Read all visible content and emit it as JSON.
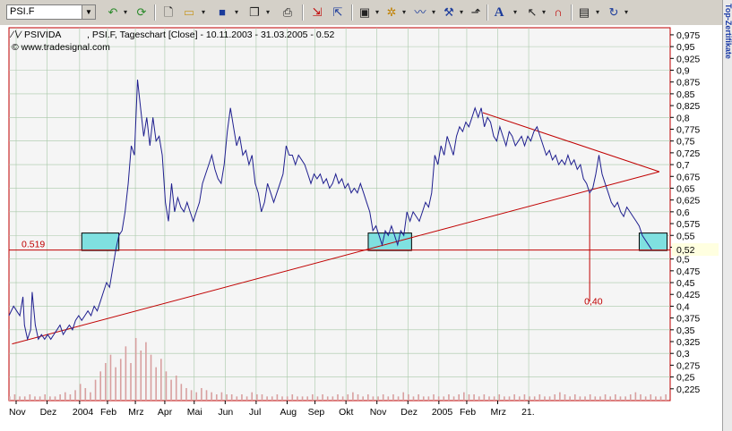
{
  "toolbar": {
    "symbol_value": "PSI.F",
    "buttons": [
      "undo-icon",
      "refresh-icon",
      "new-icon",
      "open-icon",
      "save-icon",
      "copy-icon",
      "print-icon",
      "chart-in-icon",
      "chart-out-icon",
      "window-icon",
      "studies-icon",
      "indicators-icon",
      "tools-icon",
      "trend-icon",
      "text-icon",
      "cursor-icon",
      "magnet-icon",
      "properties-icon",
      "redo-icon"
    ]
  },
  "side_panel": {
    "label": "Top-Zertifikate"
  },
  "chart_header": {
    "instrument": "PSIVIDA",
    "description": ", PSI.F, Tageschart [Close] - 10.11.2003 - 31.03.2005 - 0.52",
    "source": "© www.tradesignal.com"
  },
  "colors": {
    "price_line": "#1f1f8f",
    "annotation": "#c00000",
    "box_fill": "#7fe0e0",
    "grid": "#a8c8a8",
    "volume": "#d8a0a0",
    "frame": "#c00000"
  },
  "chart_data": {
    "type": "line",
    "title": "PSIVIDA , PSI.F, Tageschart [Close] - 10.11.2003 - 31.03.2005 - 0.52",
    "xlabel": "",
    "ylabel": "",
    "ylim": [
      0.2,
      0.99
    ],
    "grid": true,
    "x_ticks": [
      "Nov",
      "Dez",
      "2004",
      "Feb",
      "Mrz",
      "Apr",
      "Mai",
      "Jun",
      "Jul",
      "Aug",
      "Sep",
      "Okt",
      "Nov",
      "Dez",
      "2005",
      "Feb",
      "Mrz",
      "21."
    ],
    "y_ticks": [
      "0,975",
      "0,95",
      "0,925",
      "0,9",
      "0,875",
      "0,85",
      "0,825",
      "0,8",
      "0,775",
      "0,75",
      "0,725",
      "0,7",
      "0,675",
      "0,65",
      "0,625",
      "0,6",
      "0,575",
      "0,55",
      "0,525",
      "0,5",
      "0,475",
      "0,45",
      "0,425",
      "0,4",
      "0,375",
      "0,35",
      "0,325",
      "0,3",
      "0,275",
      "0,25",
      "0,225"
    ],
    "last_value_label": "0,52",
    "series": [
      {
        "values": [
          [
            0,
            0.38
          ],
          [
            3,
            0.4
          ],
          [
            5,
            0.39
          ],
          [
            7,
            0.38
          ],
          [
            9,
            0.42
          ],
          [
            10,
            0.36
          ],
          [
            12,
            0.33
          ],
          [
            14,
            0.35
          ],
          [
            15,
            0.43
          ],
          [
            17,
            0.36
          ],
          [
            19,
            0.33
          ],
          [
            21,
            0.34
          ],
          [
            23,
            0.33
          ],
          [
            25,
            0.34
          ],
          [
            27,
            0.33
          ],
          [
            29,
            0.34
          ],
          [
            31,
            0.35
          ],
          [
            33,
            0.36
          ],
          [
            35,
            0.34
          ],
          [
            37,
            0.35
          ],
          [
            39,
            0.36
          ],
          [
            41,
            0.35
          ],
          [
            43,
            0.37
          ],
          [
            45,
            0.38
          ],
          [
            47,
            0.37
          ],
          [
            49,
            0.38
          ],
          [
            51,
            0.39
          ],
          [
            53,
            0.38
          ],
          [
            55,
            0.4
          ],
          [
            57,
            0.39
          ],
          [
            59,
            0.41
          ],
          [
            61,
            0.43
          ],
          [
            63,
            0.45
          ],
          [
            65,
            0.44
          ],
          [
            67,
            0.48
          ],
          [
            69,
            0.52
          ],
          [
            71,
            0.55
          ],
          [
            73,
            0.56
          ],
          [
            75,
            0.6
          ],
          [
            77,
            0.66
          ],
          [
            79,
            0.74
          ],
          [
            81,
            0.72
          ],
          [
            83,
            0.88
          ],
          [
            85,
            0.82
          ],
          [
            87,
            0.76
          ],
          [
            89,
            0.8
          ],
          [
            91,
            0.74
          ],
          [
            93,
            0.8
          ],
          [
            95,
            0.75
          ],
          [
            97,
            0.76
          ],
          [
            99,
            0.72
          ],
          [
            101,
            0.62
          ],
          [
            103,
            0.58
          ],
          [
            105,
            0.66
          ],
          [
            107,
            0.6
          ],
          [
            109,
            0.63
          ],
          [
            111,
            0.61
          ],
          [
            113,
            0.6
          ],
          [
            115,
            0.62
          ],
          [
            117,
            0.6
          ],
          [
            119,
            0.58
          ],
          [
            121,
            0.6
          ],
          [
            123,
            0.62
          ],
          [
            125,
            0.66
          ],
          [
            127,
            0.68
          ],
          [
            129,
            0.7
          ],
          [
            131,
            0.72
          ],
          [
            133,
            0.69
          ],
          [
            135,
            0.67
          ],
          [
            137,
            0.66
          ],
          [
            139,
            0.7
          ],
          [
            141,
            0.77
          ],
          [
            143,
            0.82
          ],
          [
            145,
            0.78
          ],
          [
            147,
            0.74
          ],
          [
            149,
            0.76
          ],
          [
            151,
            0.72
          ],
          [
            153,
            0.73
          ],
          [
            155,
            0.7
          ],
          [
            157,
            0.72
          ],
          [
            159,
            0.66
          ],
          [
            161,
            0.64
          ],
          [
            163,
            0.6
          ],
          [
            165,
            0.62
          ],
          [
            167,
            0.66
          ],
          [
            169,
            0.64
          ],
          [
            171,
            0.62
          ],
          [
            173,
            0.64
          ],
          [
            175,
            0.66
          ],
          [
            177,
            0.68
          ],
          [
            179,
            0.74
          ],
          [
            181,
            0.72
          ],
          [
            183,
            0.72
          ],
          [
            185,
            0.7
          ],
          [
            187,
            0.72
          ],
          [
            189,
            0.71
          ],
          [
            191,
            0.7
          ],
          [
            193,
            0.68
          ],
          [
            195,
            0.66
          ],
          [
            197,
            0.68
          ],
          [
            199,
            0.67
          ],
          [
            201,
            0.68
          ],
          [
            203,
            0.66
          ],
          [
            205,
            0.67
          ],
          [
            207,
            0.65
          ],
          [
            209,
            0.66
          ],
          [
            211,
            0.68
          ],
          [
            213,
            0.66
          ],
          [
            215,
            0.67
          ],
          [
            217,
            0.65
          ],
          [
            219,
            0.66
          ],
          [
            221,
            0.64
          ],
          [
            223,
            0.65
          ],
          [
            225,
            0.64
          ],
          [
            227,
            0.66
          ],
          [
            229,
            0.64
          ],
          [
            231,
            0.62
          ],
          [
            233,
            0.6
          ],
          [
            235,
            0.56
          ],
          [
            237,
            0.57
          ],
          [
            239,
            0.55
          ],
          [
            241,
            0.53
          ],
          [
            243,
            0.56
          ],
          [
            245,
            0.55
          ],
          [
            247,
            0.57
          ],
          [
            249,
            0.55
          ],
          [
            251,
            0.53
          ],
          [
            253,
            0.56
          ],
          [
            255,
            0.55
          ],
          [
            257,
            0.6
          ],
          [
            259,
            0.58
          ],
          [
            261,
            0.6
          ],
          [
            263,
            0.59
          ],
          [
            265,
            0.58
          ],
          [
            267,
            0.6
          ],
          [
            269,
            0.62
          ],
          [
            271,
            0.61
          ],
          [
            273,
            0.64
          ],
          [
            275,
            0.72
          ],
          [
            277,
            0.7
          ],
          [
            279,
            0.74
          ],
          [
            281,
            0.72
          ],
          [
            283,
            0.76
          ],
          [
            285,
            0.74
          ],
          [
            287,
            0.72
          ],
          [
            289,
            0.76
          ],
          [
            291,
            0.78
          ],
          [
            293,
            0.77
          ],
          [
            295,
            0.79
          ],
          [
            297,
            0.78
          ],
          [
            299,
            0.8
          ],
          [
            301,
            0.82
          ],
          [
            303,
            0.8
          ],
          [
            305,
            0.82
          ],
          [
            307,
            0.78
          ],
          [
            309,
            0.8
          ],
          [
            311,
            0.79
          ],
          [
            313,
            0.76
          ],
          [
            315,
            0.75
          ],
          [
            317,
            0.78
          ],
          [
            319,
            0.76
          ],
          [
            321,
            0.74
          ],
          [
            323,
            0.77
          ],
          [
            325,
            0.76
          ],
          [
            327,
            0.74
          ],
          [
            329,
            0.75
          ],
          [
            331,
            0.76
          ],
          [
            333,
            0.74
          ],
          [
            335,
            0.76
          ],
          [
            337,
            0.75
          ],
          [
            339,
            0.77
          ],
          [
            341,
            0.78
          ],
          [
            343,
            0.76
          ],
          [
            345,
            0.74
          ],
          [
            347,
            0.72
          ],
          [
            349,
            0.73
          ],
          [
            351,
            0.71
          ],
          [
            353,
            0.72
          ],
          [
            355,
            0.7
          ],
          [
            357,
            0.71
          ],
          [
            359,
            0.7
          ],
          [
            361,
            0.72
          ],
          [
            363,
            0.7
          ],
          [
            365,
            0.71
          ],
          [
            367,
            0.69
          ],
          [
            369,
            0.7
          ],
          [
            371,
            0.67
          ],
          [
            373,
            0.66
          ],
          [
            375,
            0.64
          ],
          [
            377,
            0.65
          ],
          [
            379,
            0.68
          ],
          [
            381,
            0.72
          ],
          [
            383,
            0.68
          ],
          [
            385,
            0.66
          ],
          [
            387,
            0.64
          ],
          [
            389,
            0.62
          ],
          [
            391,
            0.61
          ],
          [
            393,
            0.62
          ],
          [
            395,
            0.6
          ],
          [
            397,
            0.59
          ],
          [
            399,
            0.61
          ],
          [
            401,
            0.6
          ],
          [
            403,
            0.59
          ],
          [
            405,
            0.58
          ],
          [
            407,
            0.57
          ],
          [
            409,
            0.55
          ],
          [
            411,
            0.54
          ],
          [
            413,
            0.53
          ],
          [
            415,
            0.52
          ]
        ]
      }
    ],
    "volume": [
      2,
      3,
      2,
      2,
      3,
      2,
      2,
      3,
      2,
      2,
      3,
      4,
      3,
      5,
      8,
      6,
      4,
      10,
      14,
      18,
      22,
      16,
      20,
      26,
      18,
      30,
      24,
      28,
      22,
      16,
      20,
      14,
      10,
      12,
      8,
      6,
      5,
      4,
      6,
      5,
      4,
      3,
      4,
      3,
      3,
      2,
      3,
      2,
      4,
      3,
      3,
      2,
      2,
      3,
      2,
      2,
      3,
      2,
      2,
      2,
      3,
      2,
      3,
      2,
      2,
      3,
      2,
      3,
      4,
      3,
      2,
      3,
      2,
      2,
      3,
      2,
      3,
      2,
      4,
      3,
      2,
      3,
      2,
      2,
      3,
      2,
      2,
      3,
      2,
      3,
      4,
      3,
      3,
      2,
      3,
      2,
      2,
      3,
      2,
      2,
      3,
      2,
      3,
      2,
      2,
      3,
      2,
      2,
      3,
      4,
      3,
      2,
      3,
      2,
      2,
      3,
      2,
      2,
      3,
      2,
      3,
      2,
      2,
      3,
      4,
      3,
      2,
      3,
      2,
      2,
      3
    ],
    "annotations": [
      {
        "type": "hline",
        "value": 0.519,
        "label": "0.519"
      },
      {
        "type": "text",
        "label": "0,40",
        "x": 375,
        "y": 0.4
      },
      {
        "type": "line",
        "from": [
          2,
          0.32
        ],
        "to": [
          420,
          0.685
        ]
      },
      {
        "type": "line",
        "from": [
          306,
          0.81
        ],
        "to": [
          420,
          0.685
        ]
      },
      {
        "type": "vline",
        "x": 375,
        "from": 0.64,
        "to": 0.41
      },
      {
        "type": "box",
        "x0": 47,
        "x1": 71,
        "y0": 0.518,
        "y1": 0.555
      },
      {
        "type": "box",
        "x0": 232,
        "x1": 260,
        "y0": 0.518,
        "y1": 0.555
      },
      {
        "type": "box",
        "x0": 407,
        "x1": 425,
        "y0": 0.518,
        "y1": 0.555
      }
    ]
  }
}
